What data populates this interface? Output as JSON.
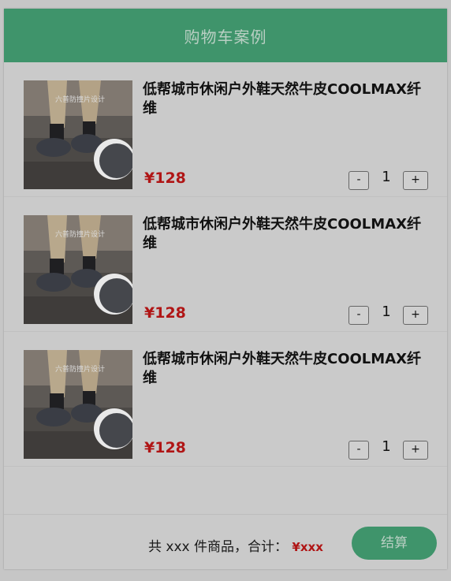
{
  "header": {
    "title": "购物车案例"
  },
  "items": [
    {
      "name": "低帮城市休闲户外鞋天然牛皮COOLMAX纤维",
      "price": "¥128",
      "qty": "1",
      "image_text": "六普防撞片设计"
    },
    {
      "name": "低帮城市休闲户外鞋天然牛皮COOLMAX纤维",
      "price": "¥128",
      "qty": "1",
      "image_text": "六普防撞片设计"
    },
    {
      "name": "低帮城市休闲户外鞋天然牛皮COOLMAX纤维",
      "price": "¥128",
      "qty": "1",
      "image_text": "六普防撞片设计"
    }
  ],
  "controls": {
    "minus_label": "-",
    "plus_label": "+"
  },
  "footer": {
    "summary_prefix": "共 xxx 件商品，合计：",
    "total": "¥xxx",
    "checkout_label": "结算"
  },
  "colors": {
    "accent": "#3f946b",
    "price": "#b01515"
  }
}
